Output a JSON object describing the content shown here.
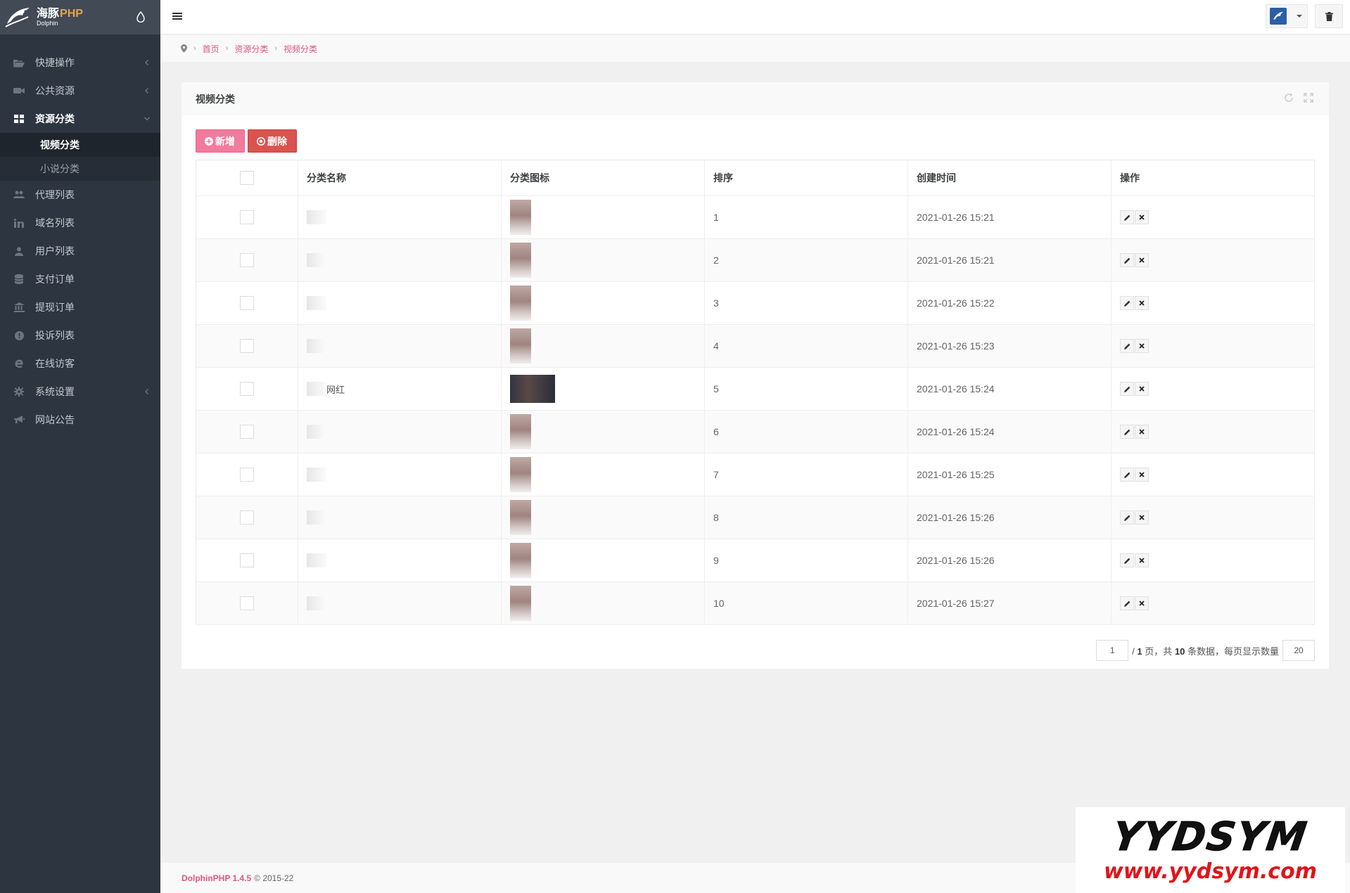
{
  "brand": {
    "title_cn": "海豚",
    "title_php": "PHP",
    "subtitle": "Dolphin"
  },
  "sidebar": {
    "items": [
      {
        "label": "快捷操作",
        "icon": "folder-open-icon",
        "has_arrow": true
      },
      {
        "label": "公共资源",
        "icon": "video-camera-icon",
        "has_arrow": true
      },
      {
        "label": "资源分类",
        "icon": "grid-icon",
        "has_arrow": true,
        "expanded": true,
        "active": true,
        "children": [
          {
            "label": "视频分类",
            "active": true
          },
          {
            "label": "小说分类",
            "active": false
          }
        ]
      },
      {
        "label": "代理列表",
        "icon": "users-icon",
        "has_arrow": false
      },
      {
        "label": "域名列表",
        "icon": "linkedin-icon",
        "has_arrow": false
      },
      {
        "label": "用户列表",
        "icon": "user-icon",
        "has_arrow": false
      },
      {
        "label": "支付订单",
        "icon": "database-icon",
        "has_arrow": false
      },
      {
        "label": "提现订单",
        "icon": "bank-icon",
        "has_arrow": false
      },
      {
        "label": "投诉列表",
        "icon": "exclamation-circle-icon",
        "has_arrow": false
      },
      {
        "label": "在线访客",
        "icon": "internet-explorer-icon",
        "has_arrow": false
      },
      {
        "label": "系统设置",
        "icon": "gear-icon",
        "has_arrow": true
      },
      {
        "label": "网站公告",
        "icon": "bullhorn-icon",
        "has_arrow": false
      }
    ]
  },
  "breadcrumb": [
    "首页",
    "资源分类",
    "视频分类"
  ],
  "panel": {
    "title": "视频分类"
  },
  "toolbar": {
    "add_label": "新增",
    "delete_label": "删除"
  },
  "table": {
    "headers": {
      "name": "分类名称",
      "icon": "分类图标",
      "sort": "排序",
      "created": "创建时间",
      "actions": "操作"
    },
    "rows": [
      {
        "name_suffix": "",
        "sort": "1",
        "created": "2021-01-26 15:21",
        "wide_thumb": false
      },
      {
        "name_suffix": "",
        "sort": "2",
        "created": "2021-01-26 15:21",
        "wide_thumb": false
      },
      {
        "name_suffix": "",
        "sort": "3",
        "created": "2021-01-26 15:22",
        "wide_thumb": false
      },
      {
        "name_suffix": "",
        "sort": "4",
        "created": "2021-01-26 15:23",
        "wide_thumb": false
      },
      {
        "name_suffix": "网红",
        "sort": "5",
        "created": "2021-01-26 15:24",
        "wide_thumb": true
      },
      {
        "name_suffix": "",
        "sort": "6",
        "created": "2021-01-26 15:24",
        "wide_thumb": false
      },
      {
        "name_suffix": "",
        "sort": "7",
        "created": "2021-01-26 15:25",
        "wide_thumb": false
      },
      {
        "name_suffix": "",
        "sort": "8",
        "created": "2021-01-26 15:26",
        "wide_thumb": false
      },
      {
        "name_suffix": "",
        "sort": "9",
        "created": "2021-01-26 15:26",
        "wide_thumb": false
      },
      {
        "name_suffix": "",
        "sort": "10",
        "created": "2021-01-26 15:27",
        "wide_thumb": false
      }
    ]
  },
  "pagination": {
    "current_page": "1",
    "total_pages": "1",
    "page_word": "页，共",
    "total_count": "10",
    "count_word": "条数据，每页显示数量",
    "per_page": "20"
  },
  "footer": {
    "brand": "DolphinPHP 1.4.5",
    "copyright": "© 2015-22"
  },
  "watermark": {
    "big": "YYDSYM",
    "url": "www.yydsym.com"
  },
  "colors": {
    "accent": "#e0567b",
    "sidebar_bg": "#2d3540",
    "add_btn": "#f27a9e",
    "del_btn": "#d9534f"
  }
}
